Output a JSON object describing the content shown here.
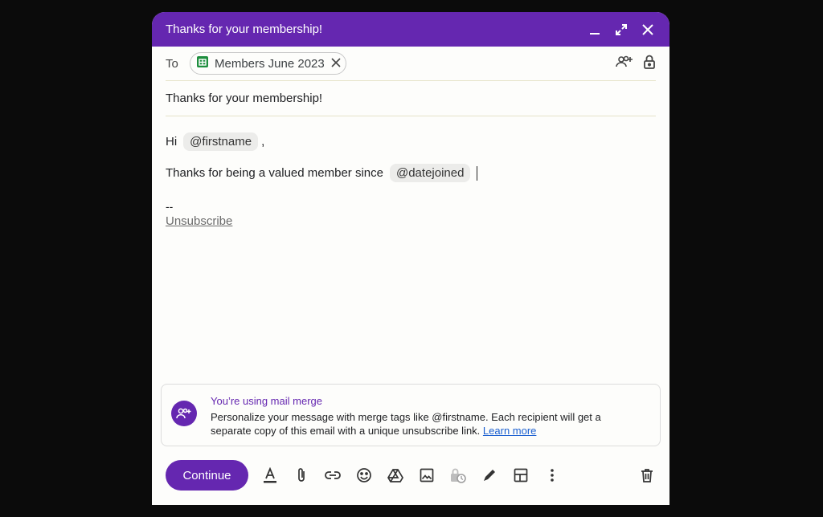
{
  "window": {
    "title": "Thanks for your membership!"
  },
  "recipients": {
    "to_label": "To",
    "chip_label": "Members June 2023"
  },
  "subject": "Thanks for your membership!",
  "body": {
    "greeting": "Hi",
    "firstname_tag": "@firstname",
    "greeting_suffix": ",",
    "line2": "Thanks for being a valued member since",
    "datejoined_tag": "@datejoined",
    "sig_sep": "--",
    "unsubscribe": "Unsubscribe"
  },
  "banner": {
    "title": "You’re using mail merge",
    "description": "Personalize your message with merge tags like @firstname. Each recipient will get a separate copy of this email with a unique unsubscribe link.",
    "learn_more": "Learn more"
  },
  "toolbar": {
    "continue_label": "Continue",
    "icons": [
      "format-text-icon",
      "attach-icon",
      "link-icon",
      "emoji-icon",
      "drive-icon",
      "image-icon",
      "confidential-icon",
      "signature-icon",
      "layout-icon",
      "more-options-icon",
      "delete-icon"
    ]
  },
  "colors": {
    "accent": "#6527b0",
    "link": "#1a5fd0",
    "sheets_green": "#1e8e3e"
  }
}
